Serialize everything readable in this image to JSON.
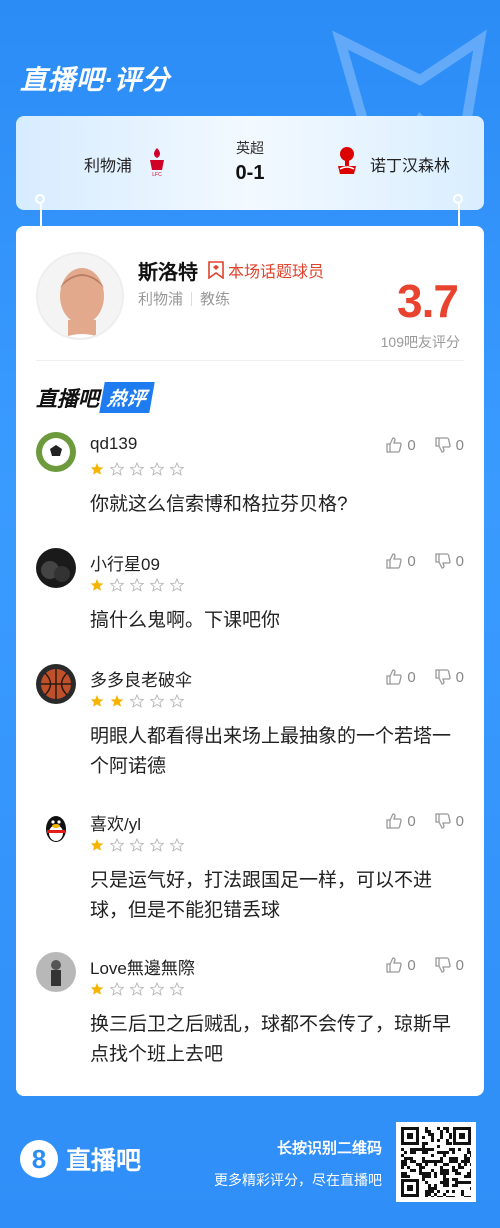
{
  "header": {
    "title": "直播吧·评分"
  },
  "match": {
    "home_team": "利物浦",
    "away_team": "诺丁汉森林",
    "league": "英超",
    "score": "0-1"
  },
  "player": {
    "name": "斯洛特",
    "badge": "本场话题球员",
    "team": "利物浦",
    "role": "教练",
    "rating": "3.7",
    "rating_count": "109吧友评分"
  },
  "section": {
    "title_a": "直播吧",
    "title_b": "热评"
  },
  "comments": [
    {
      "user": "qd139",
      "stars": 1,
      "text": "你就这么信索博和格拉芬贝格?",
      "likes": "0",
      "dislikes": "0",
      "avatar": "soccer-ball"
    },
    {
      "user": "小行星09",
      "stars": 1,
      "text": "搞什么鬼啊。下课吧你",
      "likes": "0",
      "dislikes": "0",
      "avatar": "dark-photo"
    },
    {
      "user": "多多良老破伞",
      "stars": 2,
      "text": "明眼人都看得出来场上最抽象的一个若塔一个阿诺德",
      "likes": "0",
      "dislikes": "0",
      "avatar": "basketball"
    },
    {
      "user": "喜欢/yl",
      "stars": 1,
      "text": "只是运气好，打法跟国足一样，可以不进球，但是不能犯错丢球",
      "likes": "0",
      "dislikes": "0",
      "avatar": "penguin"
    },
    {
      "user": "Love無邊無際",
      "stars": 1,
      "text": "换三后卫之后贼乱，球都不会传了，琼斯早点找个班上去吧",
      "likes": "0",
      "dislikes": "0",
      "avatar": "person-photo"
    }
  ],
  "footer": {
    "logo_text": "直播吧",
    "logo_mark": "8",
    "line1": "长按识别二维码",
    "line2": "更多精彩评分，尽在直播吧"
  },
  "colors": {
    "brand_blue": "#2c8cf6",
    "rating_red": "#e8432f",
    "star_yellow": "#f5b400"
  }
}
